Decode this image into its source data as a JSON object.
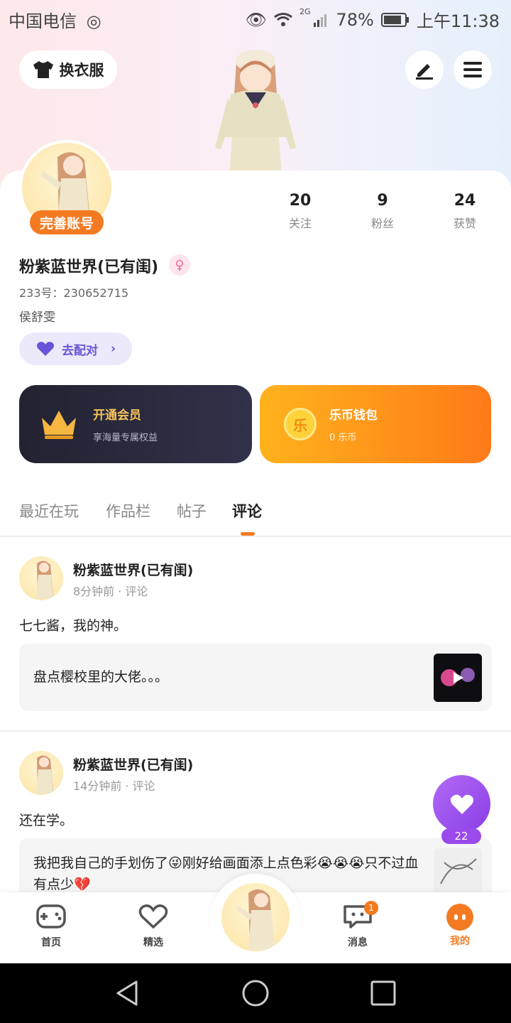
{
  "status_bar": {
    "carrier": "中国电信",
    "battery": "78%",
    "time": "上午11:38",
    "network": "2G"
  },
  "header": {
    "wardrobe_label": "换衣服"
  },
  "profile": {
    "complete_badge": "完善账号",
    "stats": [
      {
        "value": "20",
        "label": "关注"
      },
      {
        "value": "9",
        "label": "粉丝"
      },
      {
        "value": "24",
        "label": "获赞"
      }
    ],
    "name": "粉紫蓝世界(已有闺)",
    "id_text": "233号：230652715",
    "signature": "侯舒雯",
    "pair_label": "去配对"
  },
  "promos": {
    "vip": {
      "title": "开通会员",
      "subtitle": "享海量专属权益"
    },
    "wallet": {
      "title": "乐币钱包",
      "subtitle": "0 乐币",
      "coin_glyph": "乐"
    }
  },
  "tabs": [
    "最近在玩",
    "作品栏",
    "帖子",
    "评论"
  ],
  "active_tab": "评论",
  "posts": [
    {
      "author": "粉紫蓝世界(已有闺)",
      "meta": "8分钟前 · 评论",
      "text": "七七酱，我的神。",
      "quote": "盘点樱校里的大佬。。。"
    },
    {
      "author": "粉紫蓝世界(已有闺)",
      "meta": "14分钟前 · 评论",
      "text": "还在学。",
      "quote": "我把我自己的手划伤了😜刚好给画面添上点色彩😭😭😭只不过血有点少💔"
    }
  ],
  "like": {
    "count": "22"
  },
  "bottom_nav": [
    {
      "label": "首页"
    },
    {
      "label": "精选"
    },
    {
      "label": "消息",
      "badge": "1"
    },
    {
      "label": "我的"
    }
  ],
  "colors": {
    "accent": "#f47a22",
    "purple": "#9b4aec",
    "pair": "#6a53d8"
  }
}
